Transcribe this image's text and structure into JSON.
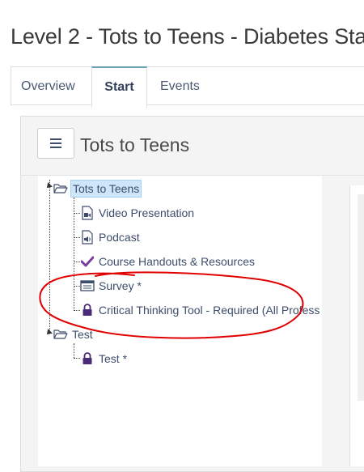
{
  "page": {
    "title": "Level 2 - Tots to Teens - Diabetes Sta"
  },
  "tabs": [
    {
      "label": "Overview",
      "active": false
    },
    {
      "label": "Start",
      "active": true
    },
    {
      "label": "Events",
      "active": false
    }
  ],
  "panel": {
    "title": "Tots to Teens",
    "menu_icon": "hamburger-icon"
  },
  "tree": [
    {
      "label": "Tots to Teens",
      "icon": "folder-open-icon",
      "level": 0,
      "selected": true
    },
    {
      "label": "Video Presentation",
      "icon": "video-file-icon",
      "level": 1
    },
    {
      "label": "Podcast",
      "icon": "audio-file-icon",
      "level": 1
    },
    {
      "label": "Course Handouts & Resources",
      "icon": "checkmark-icon",
      "level": 1
    },
    {
      "label": "Survey *",
      "icon": "survey-list-icon",
      "level": 1
    },
    {
      "label": "Critical Thinking Tool - Required (All Profess",
      "icon": "lock-icon",
      "level": 1
    },
    {
      "label": "Test",
      "icon": "folder-open-icon",
      "level": 0
    },
    {
      "label": "Test *",
      "icon": "lock-icon",
      "level": 1
    }
  ],
  "colors": {
    "annotation": "#e00000",
    "accent_tab": "#6aa0b5",
    "check": "#7a3f9e",
    "lock": "#4b2a78"
  }
}
